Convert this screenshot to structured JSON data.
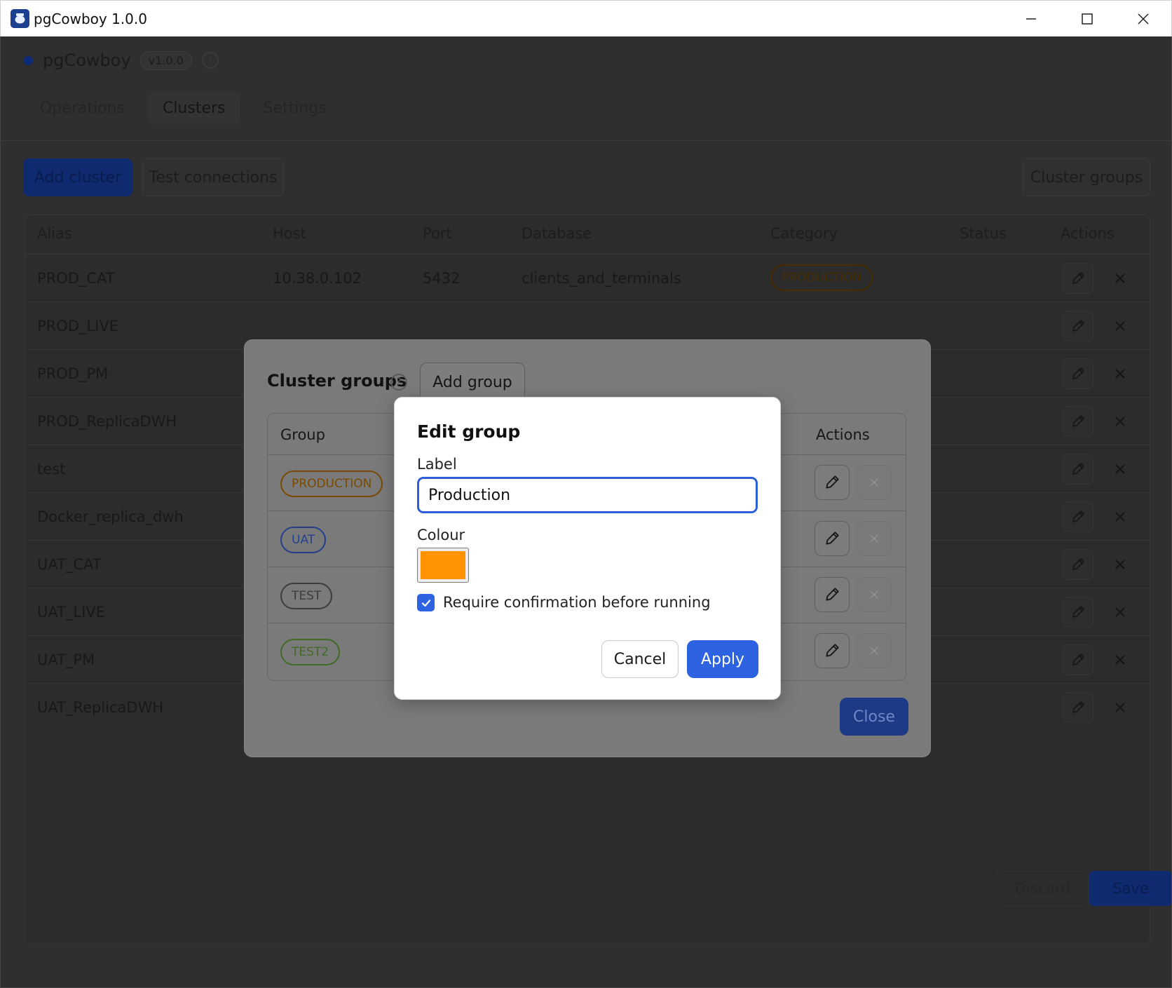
{
  "window": {
    "title": "pgCowboy 1.0.0"
  },
  "app": {
    "brand": "pgCowboy",
    "version": "v1.0.0"
  },
  "tabs": [
    {
      "label": "Operations"
    },
    {
      "label": "Clusters"
    },
    {
      "label": "Settings"
    }
  ],
  "toolbar": {
    "add_cluster": "Add cluster",
    "test_connections": "Test connections",
    "cluster_groups": "Cluster groups"
  },
  "clusters_table": {
    "columns": [
      "Alias",
      "Host",
      "Port",
      "Database",
      "Category",
      "Status",
      "Actions"
    ],
    "rows": [
      {
        "alias": "PROD_CAT",
        "host": "10.38.0.102",
        "port": "5432",
        "database": "clients_and_terminals",
        "category": "PRODUCTION",
        "status": ""
      },
      {
        "alias": "PROD_LIVE",
        "host": "",
        "port": "",
        "database": "",
        "category": "",
        "status": ""
      },
      {
        "alias": "PROD_PM",
        "host": "",
        "port": "",
        "database": "",
        "category": "",
        "status": ""
      },
      {
        "alias": "PROD_ReplicaDWH",
        "host": "",
        "port": "",
        "database": "",
        "category": "",
        "status": ""
      },
      {
        "alias": "test",
        "host": "",
        "port": "",
        "database": "",
        "category": "",
        "status": ""
      },
      {
        "alias": "Docker_replica_dwh",
        "host": "",
        "port": "",
        "database": "",
        "category": "",
        "status": ""
      },
      {
        "alias": "UAT_CAT",
        "host": "",
        "port": "",
        "database": "",
        "category": "",
        "status": ""
      },
      {
        "alias": "UAT_LIVE",
        "host": "",
        "port": "",
        "database": "",
        "category": "",
        "status": ""
      },
      {
        "alias": "UAT_PM",
        "host": "",
        "port": "",
        "database": "",
        "category": "",
        "status": ""
      },
      {
        "alias": "UAT_ReplicaDWH",
        "host": "",
        "port": "",
        "database": "",
        "category": "",
        "status": ""
      }
    ]
  },
  "footer": {
    "discard": "Discard",
    "save": "Save"
  },
  "cluster_groups_modal": {
    "title": "Cluster groups",
    "add_group": "Add group",
    "columns": [
      "Group",
      "Actions"
    ],
    "groups": [
      {
        "label": "PRODUCTION",
        "color": "#7a4a00"
      },
      {
        "label": "UAT",
        "color": "#243f8a"
      },
      {
        "label": "TEST",
        "color": "#3c3c3c"
      },
      {
        "label": "TEST2",
        "color": "#3f6b24"
      }
    ],
    "close": "Close"
  },
  "edit_group_dialog": {
    "title": "Edit group",
    "label_caption": "Label",
    "label_value": "Production",
    "colour_caption": "Colour",
    "colour_value": "#ff9400",
    "require_confirmation_label": "Require confirmation before running",
    "require_confirmation_checked": true,
    "cancel": "Cancel",
    "apply": "Apply"
  },
  "icons": {
    "app": "cowboy-elephant-icon",
    "minimize": "minimize-icon",
    "maximize": "maximize-icon",
    "close": "close-icon",
    "edit": "pencil-icon",
    "delete": "x-icon",
    "info": "info-icon",
    "help": "question-icon",
    "check": "check-icon"
  }
}
